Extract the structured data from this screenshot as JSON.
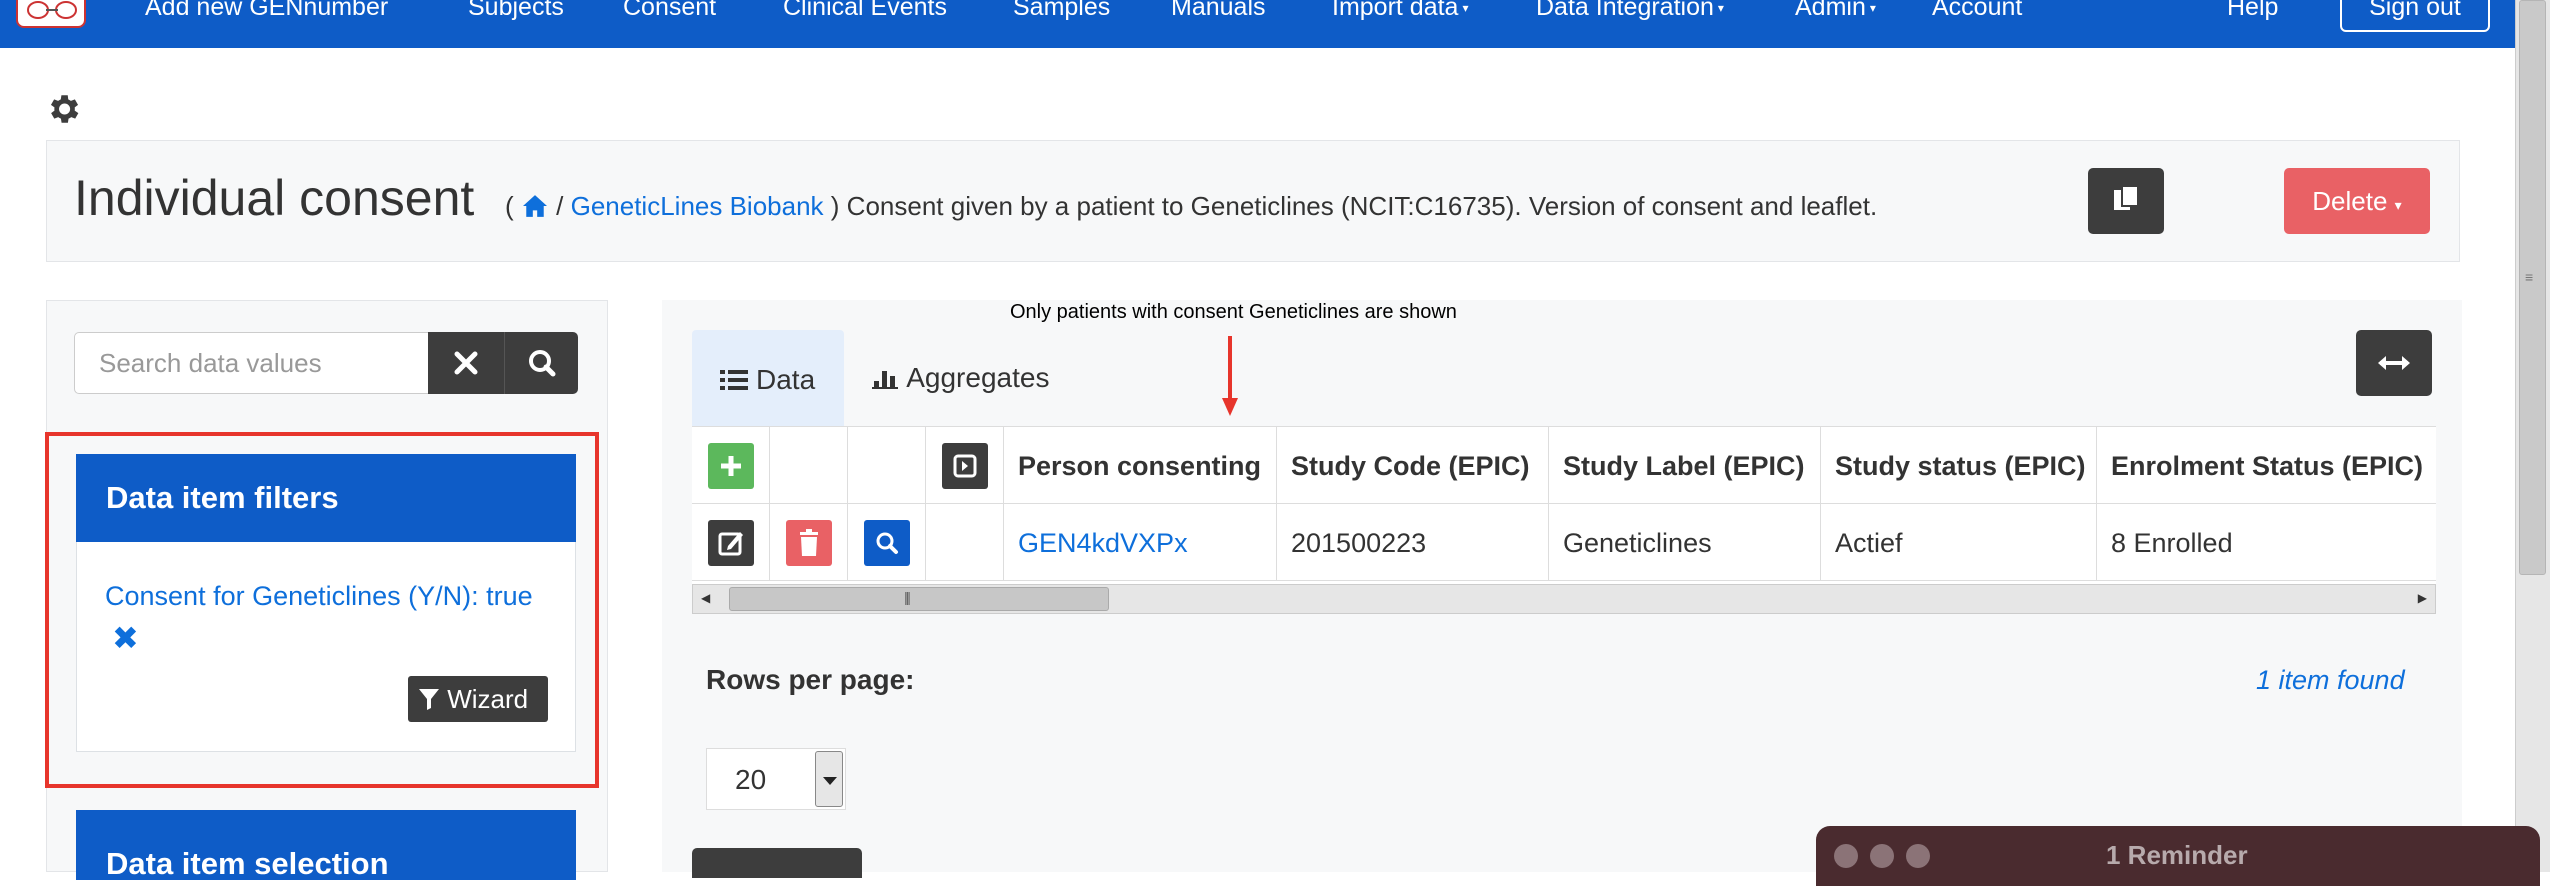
{
  "nav": {
    "items": [
      {
        "label": "Add new GENnumber",
        "dropdown": false
      },
      {
        "label": "Subjects",
        "dropdown": false
      },
      {
        "label": "Consent",
        "dropdown": false
      },
      {
        "label": "Clinical Events",
        "dropdown": false
      },
      {
        "label": "Samples",
        "dropdown": false
      },
      {
        "label": "Manuals",
        "dropdown": false
      },
      {
        "label": "Import data",
        "dropdown": true
      },
      {
        "label": "Data Integration",
        "dropdown": true
      },
      {
        "label": "Admin",
        "dropdown": true
      },
      {
        "label": "Account",
        "dropdown": false
      }
    ],
    "help": "Help",
    "sign_out": "Sign out",
    "accent": "#0e5cc7"
  },
  "header": {
    "title": "Individual consent",
    "breadcrumb_open": "(",
    "breadcrumb_sep": "/",
    "breadcrumb_link": "GeneticLines Biobank",
    "description": ") Consent given by a patient to Geneticlines (NCIT:C16735). Version of consent and leaflet.",
    "delete_label": "Delete"
  },
  "sidebar": {
    "search_placeholder": "Search data values",
    "filters_title": "Data item filters",
    "filter_text": "Consent for Geneticlines (Y/N): true",
    "wizard_label": "Wizard",
    "selection_title": "Data item selection"
  },
  "main": {
    "annotation": "Only patients with consent Geneticlines are shown",
    "tabs": [
      {
        "label": "Data",
        "active": true
      },
      {
        "label": "Aggregates",
        "active": false
      }
    ],
    "table": {
      "columns": [
        "Person consenting",
        "Study Code (EPIC)",
        "Study Label (EPIC)",
        "Study status (EPIC)",
        "Enrolment Status (EPIC)"
      ],
      "rows": [
        {
          "person": "GEN4kdVXPx",
          "study_code": "201500223",
          "study_label": "Geneticlines",
          "study_status": "Actief",
          "enrolment": "8 Enrolled"
        }
      ]
    },
    "rows_per_page_label": "Rows per page:",
    "rows_per_page_value": "20",
    "items_found": "1 item found"
  },
  "reminder": {
    "title": "1 Reminder"
  },
  "colors": {
    "primary": "#0e5cc7",
    "danger": "#e96165",
    "dark_button": "#3d3d3d",
    "link": "#0e6fdb",
    "highlight": "#e7352c"
  }
}
